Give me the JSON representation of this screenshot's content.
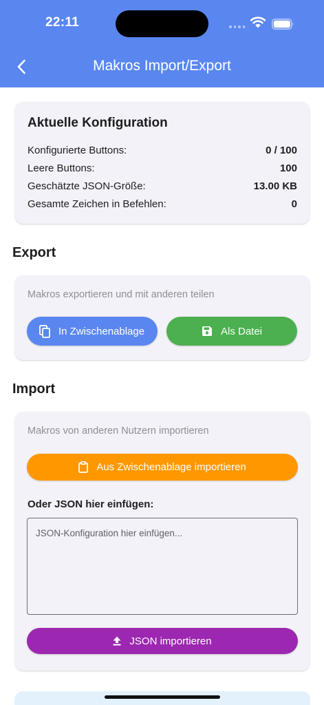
{
  "status_bar": {
    "time": "22:11"
  },
  "nav": {
    "title": "Makros Import/Export"
  },
  "config": {
    "title": "Aktuelle Konfiguration",
    "rows": [
      {
        "label": "Konfigurierte Buttons:",
        "value": "0 / 100"
      },
      {
        "label": "Leere Buttons:",
        "value": "100"
      },
      {
        "label": "Geschätzte JSON-Größe:",
        "value": "13.00 KB"
      },
      {
        "label": "Gesamte Zeichen in Befehlen:",
        "value": "0"
      }
    ]
  },
  "export": {
    "title": "Export",
    "hint": "Makros exportieren und mit anderen teilen",
    "clipboard_label": "In Zwischenablage",
    "file_label": "Als Datei"
  },
  "import": {
    "title": "Import",
    "hint": "Makros von anderen Nutzern importieren",
    "clipboard_label": "Aus Zwischenablage importieren",
    "json_label": "Oder JSON hier einfügen:",
    "json_placeholder": "JSON-Konfiguration hier einfügen...",
    "json_value": "",
    "import_label": "JSON importieren"
  },
  "colors": {
    "primary": "#5a86f0",
    "export_file": "#4caf50",
    "import_clipboard": "#ff9800",
    "import_json": "#9c27b0"
  },
  "icons": {
    "back": "chevron-left-icon",
    "copy": "copy-icon",
    "save": "save-icon",
    "clipboard": "clipboard-icon",
    "upload": "upload-icon"
  }
}
